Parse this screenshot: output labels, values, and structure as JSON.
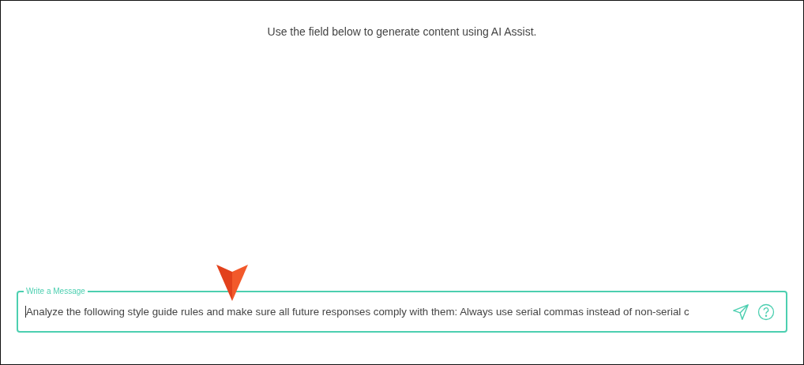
{
  "instruction": "Use the field below to generate content using AI Assist.",
  "message_field": {
    "label": "Write a Message",
    "value": "Analyze the following style guide rules and make sure all future responses comply with them: Always use serial commas instead of non-serial c",
    "focused": true
  }
}
